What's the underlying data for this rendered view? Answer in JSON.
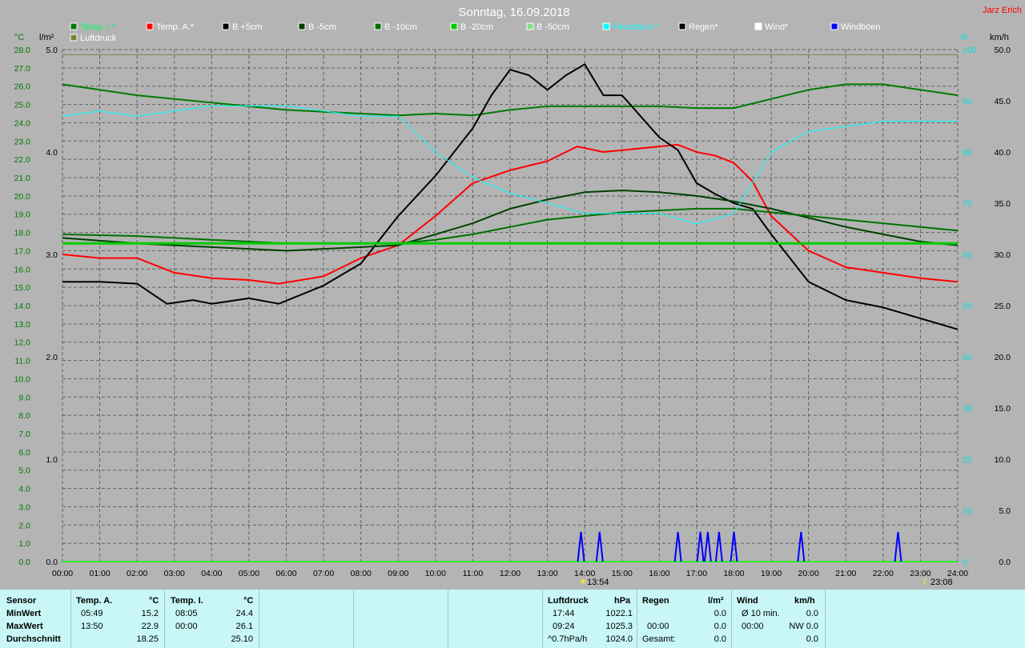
{
  "title": "Sonntag, 16.09.2018",
  "author": "Jarz Erich",
  "axes": {
    "left_unit_1": "°C",
    "left_unit_2": "l/m²",
    "right_unit_1": "%",
    "right_unit_2": "km/h",
    "temp_ticks": [
      "28.0",
      "27.0",
      "26.0",
      "25.0",
      "24.0",
      "23.0",
      "22.0",
      "21.0",
      "20.0",
      "19.0",
      "18.0",
      "17.0",
      "16.0",
      "15.0",
      "14.0",
      "13.0",
      "12.0",
      "11.0",
      "10.0",
      "9.0",
      "8.0",
      "7.0",
      "6.0",
      "5.0",
      "4.0",
      "3.0",
      "2.0",
      "1.0",
      "0.0"
    ],
    "rain_ticks": [
      "5.0",
      "4.0",
      "3.0",
      "2.0",
      "1.0",
      "0.0"
    ],
    "hum_ticks": [
      "100",
      "90",
      "80",
      "70",
      "60",
      "50",
      "40",
      "30",
      "20",
      "10",
      "0"
    ],
    "wind_ticks": [
      "50.0",
      "45.0",
      "40.0",
      "35.0",
      "30.0",
      "25.0",
      "20.0",
      "15.0",
      "10.0",
      "5.0",
      "0.0"
    ],
    "x_ticks": [
      "00:00",
      "01:00",
      "02:00",
      "03:00",
      "04:00",
      "05:00",
      "06:00",
      "07:00",
      "08:00",
      "09:00",
      "10:00",
      "11:00",
      "12:00",
      "13:00",
      "14:00",
      "15:00",
      "16:00",
      "17:00",
      "18:00",
      "19:00",
      "20:00",
      "21:00",
      "22:00",
      "23:00",
      "24:00"
    ]
  },
  "markers": {
    "sun_mark": "13:54",
    "moon_mark": "23:08"
  },
  "legend": [
    {
      "label": "Temp. I.*",
      "color": "#007a00"
    },
    {
      "label": "Temp. A.*",
      "color": "#ff0000"
    },
    {
      "label": "B +5cm",
      "color": "#000000"
    },
    {
      "label": "B -5cm",
      "color": "#004000"
    },
    {
      "label": "B -10cm",
      "color": "#007000"
    },
    {
      "label": "B -20cm",
      "color": "#00cc00"
    },
    {
      "label": "B -50cm",
      "color": "#80e080"
    },
    {
      "label": "Feuchte A.*",
      "color": "#00ffff"
    },
    {
      "label": "Regen*",
      "color": "#000000"
    },
    {
      "label": "Wind*",
      "color": "#ffffff"
    },
    {
      "label": "Windböen",
      "color": "#0000ff"
    },
    {
      "label": "Luftdruck",
      "color": "#808040"
    }
  ],
  "chart_data": {
    "type": "line",
    "x_range": [
      "00:00",
      "24:00"
    ],
    "ylim_temp": [
      0,
      28
    ],
    "ylim_rain": [
      0,
      5
    ],
    "ylim_humidity": [
      0,
      100
    ],
    "ylim_wind": [
      0,
      50
    ],
    "grid": true,
    "series": [
      {
        "name": "Temp. I.*",
        "axis": "temp",
        "color": "#007a00",
        "x": [
          0,
          1,
          2,
          3,
          4,
          5,
          6,
          7,
          8,
          9,
          10,
          11,
          12,
          13,
          14,
          15,
          16,
          17,
          18,
          19,
          20,
          21,
          22,
          23,
          24
        ],
        "y": [
          26.1,
          25.8,
          25.5,
          25.3,
          25.1,
          24.9,
          24.7,
          24.6,
          24.5,
          24.4,
          24.5,
          24.4,
          24.7,
          24.9,
          24.9,
          24.9,
          24.9,
          24.8,
          24.8,
          25.3,
          25.8,
          26.1,
          26.1,
          25.8,
          25.5
        ]
      },
      {
        "name": "Temp. A.*",
        "axis": "temp",
        "color": "#ff0000",
        "x": [
          0,
          1,
          2,
          3,
          4,
          5,
          5.8,
          7,
          8,
          9,
          10,
          11,
          12,
          13,
          13.8,
          14.5,
          15,
          16,
          16.5,
          17,
          17.5,
          18,
          18.5,
          19,
          20,
          21,
          22,
          23,
          24
        ],
        "y": [
          16.8,
          16.6,
          16.6,
          15.8,
          15.5,
          15.4,
          15.2,
          15.6,
          16.6,
          17.3,
          18.9,
          20.7,
          21.4,
          21.9,
          22.7,
          22.4,
          22.5,
          22.7,
          22.8,
          22.4,
          22.2,
          21.8,
          20.8,
          18.9,
          17.0,
          16.1,
          15.8,
          15.5,
          15.3
        ]
      },
      {
        "name": "B +5cm",
        "axis": "temp",
        "color": "#000000",
        "x": [
          0,
          1,
          2,
          2.8,
          3.5,
          4,
          5,
          5.8,
          7,
          8,
          9,
          10,
          11,
          11.5,
          12,
          12.5,
          13,
          13.5,
          14,
          14.5,
          15,
          16,
          16.5,
          17,
          17.5,
          18,
          18.5,
          19,
          20,
          21,
          22,
          23,
          24
        ],
        "y": [
          15.3,
          15.3,
          15.2,
          14.1,
          14.3,
          14.1,
          14.4,
          14.1,
          15.1,
          16.3,
          18.9,
          21.1,
          23.7,
          25.5,
          26.9,
          26.6,
          25.8,
          26.6,
          27.2,
          25.5,
          25.5,
          23.2,
          22.5,
          20.7,
          20.1,
          19.6,
          19.3,
          17.9,
          15.3,
          14.3,
          13.9,
          13.3,
          12.7
        ]
      },
      {
        "name": "B -5cm",
        "axis": "temp",
        "color": "#004000",
        "x": [
          0,
          2,
          4,
          6,
          8,
          9,
          10,
          11,
          12,
          13,
          14,
          15,
          16,
          17,
          18,
          19,
          20,
          21,
          22,
          23,
          24
        ],
        "y": [
          17.7,
          17.4,
          17.2,
          17.0,
          17.2,
          17.3,
          17.9,
          18.5,
          19.3,
          19.8,
          20.2,
          20.3,
          20.2,
          20.0,
          19.7,
          19.3,
          18.8,
          18.3,
          17.9,
          17.5,
          17.3
        ]
      },
      {
        "name": "B -10cm",
        "axis": "temp",
        "color": "#007000",
        "x": [
          0,
          2,
          4,
          6,
          8,
          9,
          10,
          11,
          12,
          13,
          14,
          15,
          16,
          17,
          18,
          19,
          20,
          21,
          22,
          23,
          24
        ],
        "y": [
          17.9,
          17.8,
          17.6,
          17.4,
          17.4,
          17.4,
          17.6,
          17.9,
          18.3,
          18.7,
          18.9,
          19.1,
          19.2,
          19.3,
          19.3,
          19.1,
          18.9,
          18.7,
          18.5,
          18.3,
          18.1
        ]
      },
      {
        "name": "B -20cm",
        "axis": "temp",
        "color": "#00cc00",
        "x": [
          0,
          24
        ],
        "y": [
          17.4,
          17.4
        ]
      },
      {
        "name": "Feuchte A.*",
        "axis": "humidity",
        "color": "#00ffff",
        "x": [
          0,
          1,
          2,
          3,
          4,
          5,
          6,
          7,
          8,
          9,
          10,
          11,
          12,
          13,
          14,
          15,
          16,
          17,
          18,
          19,
          20,
          21,
          22,
          23,
          24
        ],
        "y": [
          87,
          88,
          87,
          88,
          89,
          89,
          89,
          88,
          87,
          87,
          80,
          75,
          72,
          70,
          68,
          68,
          68,
          66,
          68,
          80,
          84,
          85,
          86,
          86,
          86
        ]
      },
      {
        "name": "Luftdruck",
        "axis": "rain_scale",
        "color": "#808040",
        "x": [
          0,
          2,
          4,
          6,
          8,
          10,
          12,
          14,
          16,
          18,
          19,
          20,
          22,
          23,
          24
        ],
        "y": [
          4.95,
          4.95,
          4.95,
          4.95,
          4.95,
          4.95,
          4.95,
          4.95,
          4.95,
          4.95,
          4.95,
          4.95,
          4.95,
          4.95,
          4.95
        ]
      },
      {
        "name": "Windböen",
        "axis": "wind",
        "color": "#0000ff",
        "x": [
          13.9,
          14.4,
          16.5,
          17.1,
          17.3,
          17.6,
          18.0,
          19.8,
          22.4
        ],
        "y": [
          1.5,
          1.5,
          1.5,
          1.5,
          1.5,
          1.5,
          1.5,
          1.5,
          1.5
        ]
      }
    ]
  },
  "stats": {
    "sensor_label": "Sensor",
    "minwert_label": "MinWert",
    "maxwert_label": "MaxWert",
    "durchschnitt_label": "Durchschnitt",
    "temp_a_header": "Temp. A.",
    "temp_a_unit": "°C",
    "temp_a_min_time": "05:49",
    "temp_a_min": "15.2",
    "temp_a_max_time": "13:50",
    "temp_a_max": "22.9",
    "temp_a_avg": "18.25",
    "temp_i_header": "Temp. I.",
    "temp_i_unit": "°C",
    "temp_i_min_time": "08:05",
    "temp_i_min": "24.4",
    "temp_i_max_time": "00:00",
    "temp_i_max": "26.1",
    "temp_i_avg": "25.10",
    "luftdruck_header": "Luftdruck",
    "luftdruck_unit": "hPa",
    "luftdruck_min_time": "17:44",
    "luftdruck_min": "1022.1",
    "luftdruck_max_time": "09:24",
    "luftdruck_max": "1025.3",
    "luftdruck_trend": "^0.7hPa/h",
    "luftdruck_avg": "1024.0",
    "regen_header": "Regen",
    "regen_unit": "l/m²",
    "regen_row2_time": "00:00",
    "regen_row2_value": "0.0",
    "regen_gesamt_label": "Gesamt:",
    "regen_gesamt_value": "0.0",
    "regen_row1_value": "0.0",
    "wind_header": "Wind",
    "wind_unit": "km/h",
    "wind_avg_label": "Ø 10 min.",
    "wind_avg_value": "0.0",
    "wind_max_time": "00:00",
    "wind_max_value": "NW 0.0",
    "wind_total_value": "0.0"
  }
}
